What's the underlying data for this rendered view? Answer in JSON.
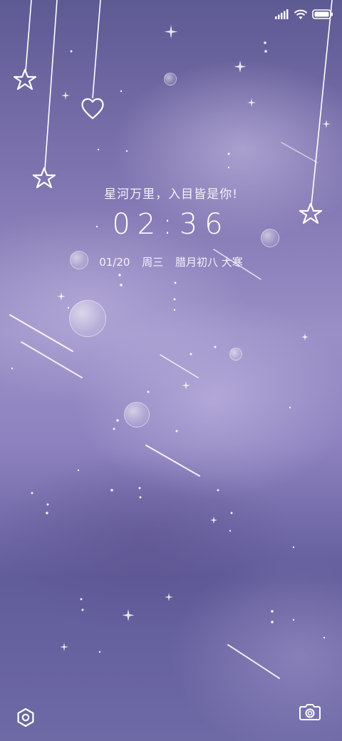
{
  "lockscreen": {
    "tagline": "星河万里，入目皆是你!",
    "time": "02:36",
    "date": "01/20",
    "weekday": "周三",
    "lunar": "腊月初八 大寒"
  },
  "status_bar": {
    "icons": [
      "signal-icon",
      "wifi-icon",
      "battery-icon"
    ]
  },
  "shortcuts": {
    "left": "settings-icon",
    "right": "camera-icon"
  },
  "colors": {
    "text": "#ffffff",
    "sky_dark": "#5e5a93",
    "sky_light": "#9a8fc6"
  }
}
